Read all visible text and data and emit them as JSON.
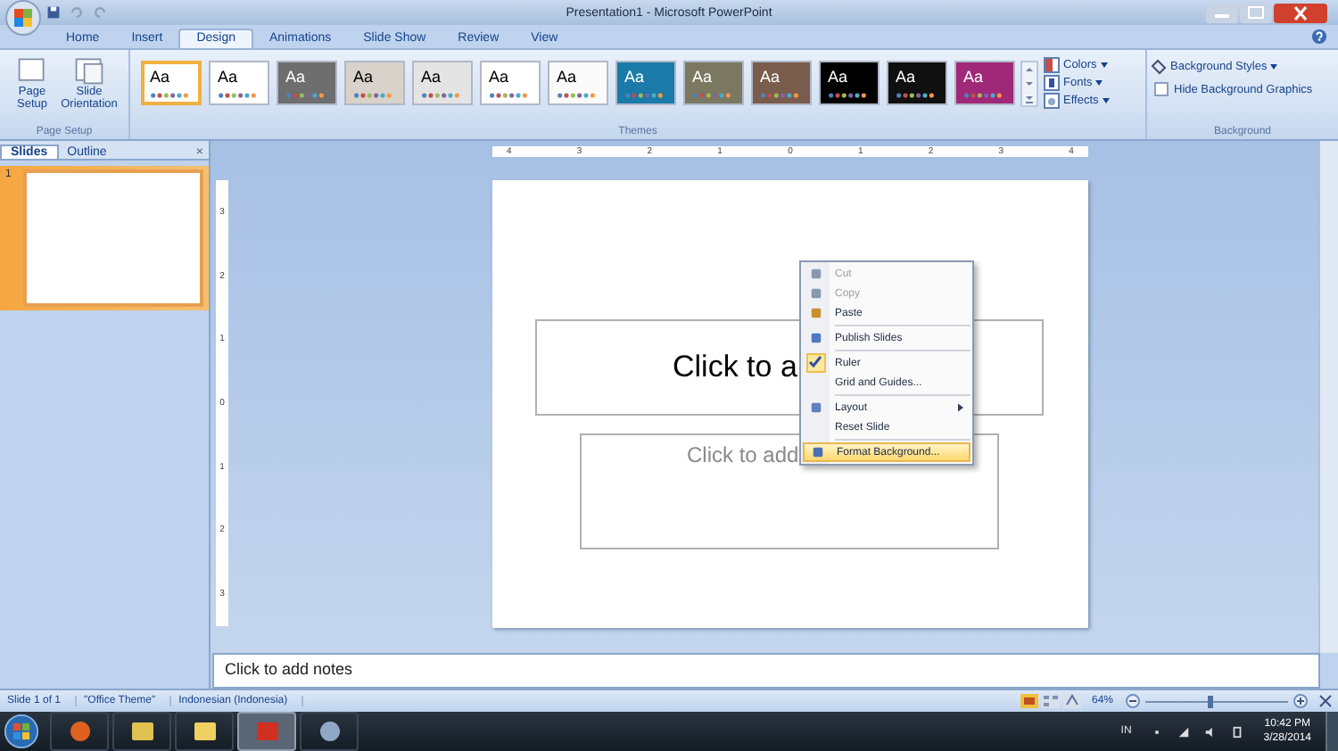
{
  "window": {
    "title": "Presentation1 - Microsoft PowerPoint"
  },
  "tabs": [
    {
      "label": "Home",
      "selected": false
    },
    {
      "label": "Insert",
      "selected": false
    },
    {
      "label": "Design",
      "selected": true
    },
    {
      "label": "Animations",
      "selected": false
    },
    {
      "label": "Slide Show",
      "selected": false
    },
    {
      "label": "Review",
      "selected": false
    },
    {
      "label": "View",
      "selected": false
    }
  ],
  "page_setup_group": {
    "buttons": [
      "Page Setup",
      "Slide Orientation"
    ],
    "label": "Page Setup"
  },
  "themes": [
    {
      "label": "Aa",
      "color": "#ffffff",
      "selected": true
    },
    {
      "label": "Aa",
      "color": "#ffffff",
      "selected": false
    },
    {
      "label": "Aa",
      "color": "#6e6e6e",
      "selected": false
    },
    {
      "label": "Aa",
      "color": "#d8d2ca",
      "selected": false
    },
    {
      "label": "Aa",
      "color": "#e4e4e4",
      "selected": false
    },
    {
      "label": "Aa",
      "color": "#ffffff",
      "selected": false
    },
    {
      "label": "Aa",
      "color": "#fafafa",
      "selected": false
    },
    {
      "label": "Aa",
      "color": "#1a7aa8",
      "selected": false
    },
    {
      "label": "Aa",
      "color": "#7a7860",
      "selected": false
    },
    {
      "label": "Aa",
      "color": "#7a5c4c",
      "selected": false
    },
    {
      "label": "Aa",
      "color": "#000000",
      "selected": false
    },
    {
      "label": "Aa",
      "color": "#101010",
      "selected": false
    },
    {
      "label": "Aa",
      "color": "#a02878",
      "selected": false
    }
  ],
  "themes_group": {
    "options": [
      "Colors",
      "Fonts",
      "Effects"
    ],
    "label": "Themes"
  },
  "background_group": {
    "styles_button": "Background Styles",
    "hide_graphics": {
      "label": "Hide Background Graphics",
      "checked": false
    },
    "label": "Background"
  },
  "slides_pane": {
    "tabs": [
      {
        "label": "Slides",
        "selected": true
      },
      {
        "label": "Outline",
        "selected": false
      }
    ],
    "close": "×",
    "slides": [
      {
        "number": "1",
        "selected": true
      }
    ]
  },
  "rulers": {
    "horizontal": [
      "4",
      "3",
      "2",
      "1",
      "0",
      "1",
      "2",
      "3",
      "4"
    ],
    "vertical": [
      "3",
      "2",
      "1",
      "0",
      "1",
      "2",
      "3"
    ]
  },
  "slide": {
    "title": "Click to a",
    "subtitle": "Click to add"
  },
  "context_menu": [
    {
      "kind": "item",
      "label": "Cut",
      "disabled": true,
      "checked": false,
      "selected": false,
      "submenu": false
    },
    {
      "kind": "item",
      "label": "Copy",
      "disabled": true,
      "checked": false,
      "selected": false,
      "submenu": false
    },
    {
      "kind": "item",
      "label": "Paste",
      "disabled": false,
      "checked": false,
      "selected": false,
      "submenu": false
    },
    {
      "kind": "separator"
    },
    {
      "kind": "item",
      "label": "Publish Slides",
      "disabled": false,
      "checked": false,
      "selected": false,
      "submenu": false
    },
    {
      "kind": "separator"
    },
    {
      "kind": "item",
      "label": "Ruler",
      "disabled": false,
      "checked": true,
      "selected": false,
      "submenu": false
    },
    {
      "kind": "item",
      "label": "Grid and Guides...",
      "disabled": false,
      "checked": false,
      "selected": false,
      "submenu": false
    },
    {
      "kind": "separator"
    },
    {
      "kind": "item",
      "label": "Layout",
      "disabled": false,
      "checked": false,
      "selected": false,
      "submenu": true
    },
    {
      "kind": "item",
      "label": "Reset Slide",
      "disabled": false,
      "checked": false,
      "selected": false,
      "submenu": false
    },
    {
      "kind": "separator"
    },
    {
      "kind": "item",
      "label": "Format Background...",
      "disabled": false,
      "checked": false,
      "selected": true,
      "submenu": false
    }
  ],
  "notes": {
    "placeholder": "Click to add notes"
  },
  "status_bar": {
    "items": [
      "Slide 1 of 1",
      "\"Office Theme\"",
      "Indonesian (Indonesia)"
    ],
    "zoom": "64%",
    "zoom_level": {
      "level": 0.45
    }
  },
  "taskbar": {
    "apps": [
      {
        "selected": false
      },
      {
        "selected": false
      },
      {
        "selected": false
      },
      {
        "selected": true
      },
      {
        "selected": false
      }
    ],
    "language": "IN",
    "time": "10:42 PM",
    "date": "3/28/2014"
  }
}
